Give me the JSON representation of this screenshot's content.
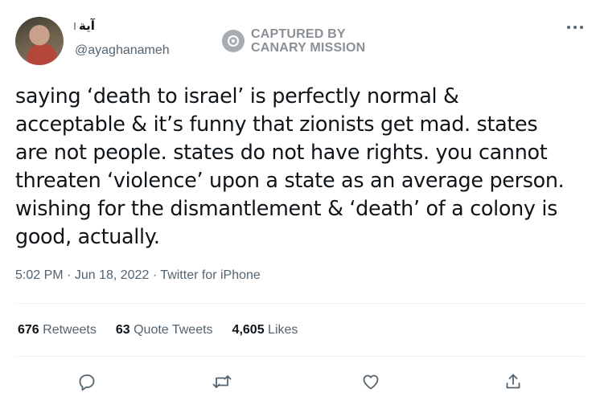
{
  "author": {
    "display_name": "آية",
    "handle": "@ayaghanameh"
  },
  "watermark": {
    "line1": "CAPTURED BY",
    "line2": "CANARY MISSION"
  },
  "tweet": {
    "lines": [
      "saying ‘death to israel’ is perfectly normal &",
      "acceptable & it’s funny that zionists get mad. states",
      "are not people. states do not have rights. you cannot",
      "threaten ‘violence’ upon a state as an average person.",
      "wishing for the dismantlement & ‘death’ of a colony is",
      "good, actually."
    ],
    "time": "5:02 PM",
    "date": "Jun 18, 2022",
    "source": "Twitter for iPhone"
  },
  "stats": {
    "retweets_count": "676",
    "retweets_label": "Retweets",
    "quotes_count": "63",
    "quotes_label": "Quote Tweets",
    "likes_count": "4,605",
    "likes_label": "Likes"
  },
  "colors": {
    "text": "#0f1419",
    "secondary": "#536471",
    "divider": "#eff3f4"
  },
  "icons": [
    "more-icon",
    "reply-icon",
    "retweet-icon",
    "like-icon",
    "share-icon",
    "captured-badge-icon"
  ]
}
